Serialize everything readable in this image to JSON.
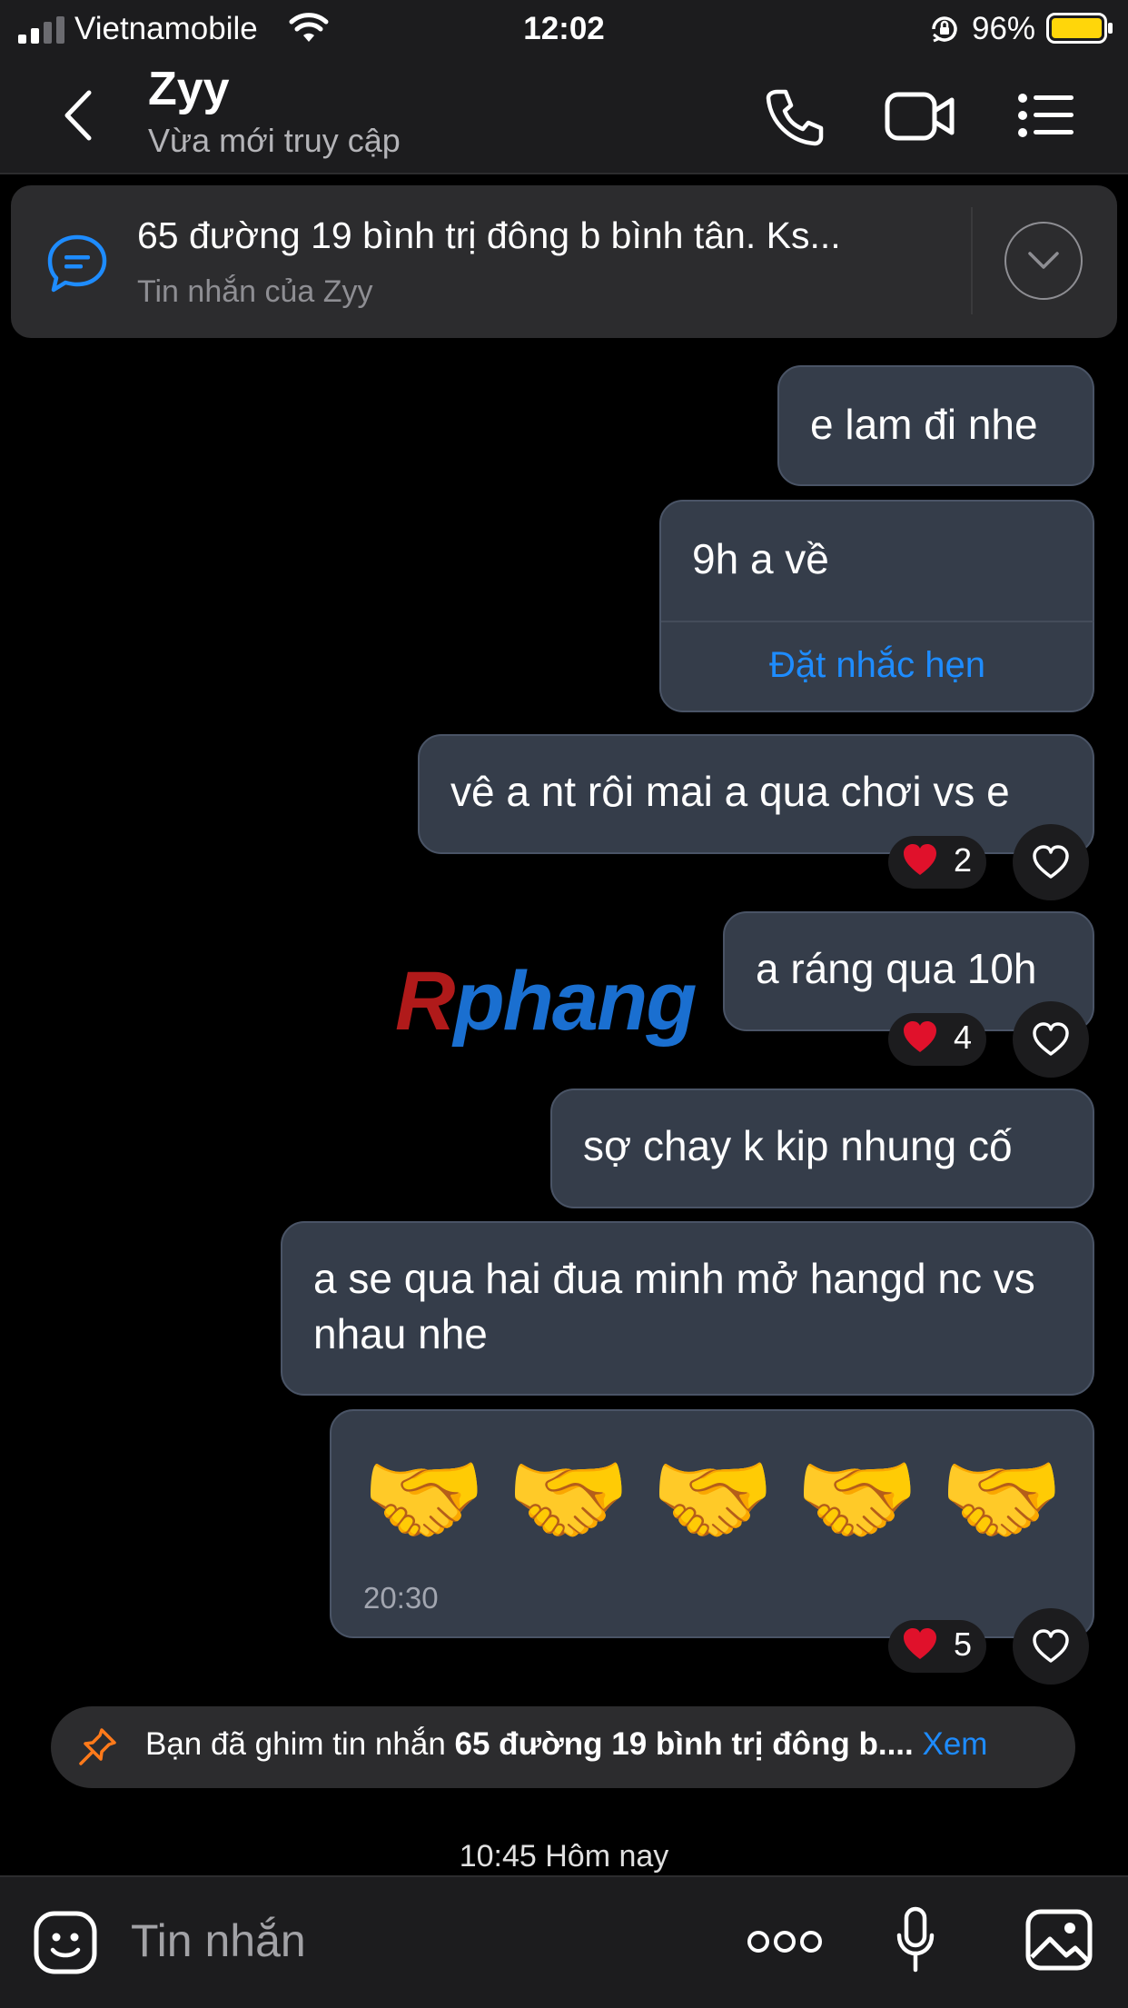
{
  "status_bar": {
    "carrier": "Vietnamobile",
    "time": "12:02",
    "battery": "96%"
  },
  "header": {
    "name": "Zyy",
    "status": "Vừa mới truy cập"
  },
  "pinned_banner": {
    "text": "65 đường 19 bình trị đông b bình tân. Ks...",
    "sub": "Tin nhắn của Zyy"
  },
  "messages": [
    {
      "text": "e lam đi nhe"
    },
    {
      "text": "9h a về",
      "action": "Đặt nhắc hẹn"
    },
    {
      "text": "vê a nt rôi mai a qua chơi vs e",
      "reaction_count": "2"
    },
    {
      "text": "a ráng qua 10h",
      "reaction_count": "4"
    },
    {
      "text": "sợ chay k kip nhung cố"
    },
    {
      "text": "a se qua hai đua minh mở hangd nc vs nhau nhe"
    },
    {
      "emoji": "🤝",
      "emoji_count": 5,
      "time": "20:30",
      "reaction_count": "5"
    }
  ],
  "pin_notice": {
    "prefix": "Bạn đã ghim tin nhắn",
    "bold": "65 đường 19 bình trị đông b....",
    "link": "Xem"
  },
  "date_stamp": "10:45 Hôm nay",
  "input": {
    "placeholder": "Tin nhắn"
  },
  "watermark": {
    "first": "R",
    "rest": "phang"
  },
  "colors": {
    "bubble": "#353d4a",
    "accent": "#1e8cff",
    "background": "#000000",
    "reaction_heart": "#e0112b"
  },
  "icons": [
    "signal-icon",
    "wifi-icon",
    "rotation-lock-icon",
    "battery-icon",
    "back-icon",
    "phone-icon",
    "video-icon",
    "menu-icon",
    "chat-bubble-icon",
    "chevron-down-icon",
    "heart-icon",
    "like-icon",
    "pin-icon",
    "sticker-icon",
    "more-icon",
    "mic-icon",
    "image-icon"
  ]
}
